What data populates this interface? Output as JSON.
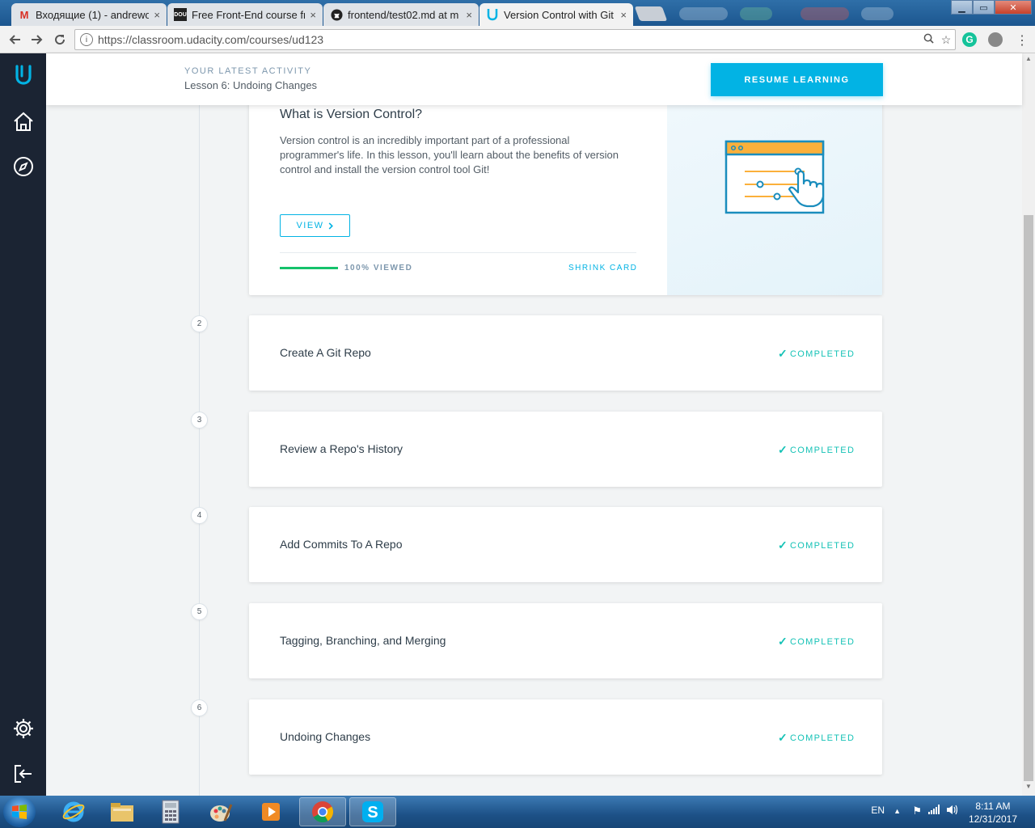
{
  "browser": {
    "tabs": [
      {
        "title": "Входящие (1) - andrewo",
        "favicon": "gmail-icon",
        "favicon_text": "M"
      },
      {
        "title": "Free Front-End course fro",
        "favicon": "dou-icon",
        "favicon_text": "DOU"
      },
      {
        "title": "frontend/test02.md at m",
        "favicon": "github-icon",
        "favicon_text": ""
      },
      {
        "title": "Version Control with Git",
        "favicon": "udacity-icon",
        "favicon_text": ""
      }
    ],
    "close_glyph": "×",
    "url": "https://classroom.udacity.com/courses/ud123",
    "ext_grammarly": "G"
  },
  "header": {
    "activity_label": "YOUR LATEST ACTIVITY",
    "activity_lesson": "Lesson 6: Undoing Changes",
    "resume_button": "RESUME LEARNING"
  },
  "lesson1": {
    "title": "What is Version Control?",
    "description": "Version control is an incredibly important part of a professional programmer's life. In this lesson, you'll learn about the benefits of version control and install the version control tool Git!",
    "view_button": "VIEW",
    "progress_fraction": 1.0,
    "viewed_label": "100% VIEWED",
    "shrink_label": "SHRINK CARD"
  },
  "lessons": [
    {
      "number": "2",
      "title": "Create A Git Repo",
      "status": "COMPLETED"
    },
    {
      "number": "3",
      "title": "Review a Repo's History",
      "status": "COMPLETED"
    },
    {
      "number": "4",
      "title": "Add Commits To A Repo",
      "status": "COMPLETED"
    },
    {
      "number": "5",
      "title": "Tagging, Branching, and Merging",
      "status": "COMPLETED"
    },
    {
      "number": "6",
      "title": "Undoing Changes",
      "status": "COMPLETED"
    }
  ],
  "taskbar": {
    "language": "EN",
    "time": "8:11 AM",
    "date": "12/31/2017",
    "apps": [
      "internet-explorer-icon",
      "file-explorer-icon",
      "calculator-icon",
      "paint-icon",
      "media-player-icon",
      "chrome-icon",
      "skype-icon"
    ]
  },
  "colors": {
    "accent": "#02b3e4",
    "completed": "#15c2b6",
    "progress": "#15c26b",
    "sidebar": "#1b2433"
  }
}
